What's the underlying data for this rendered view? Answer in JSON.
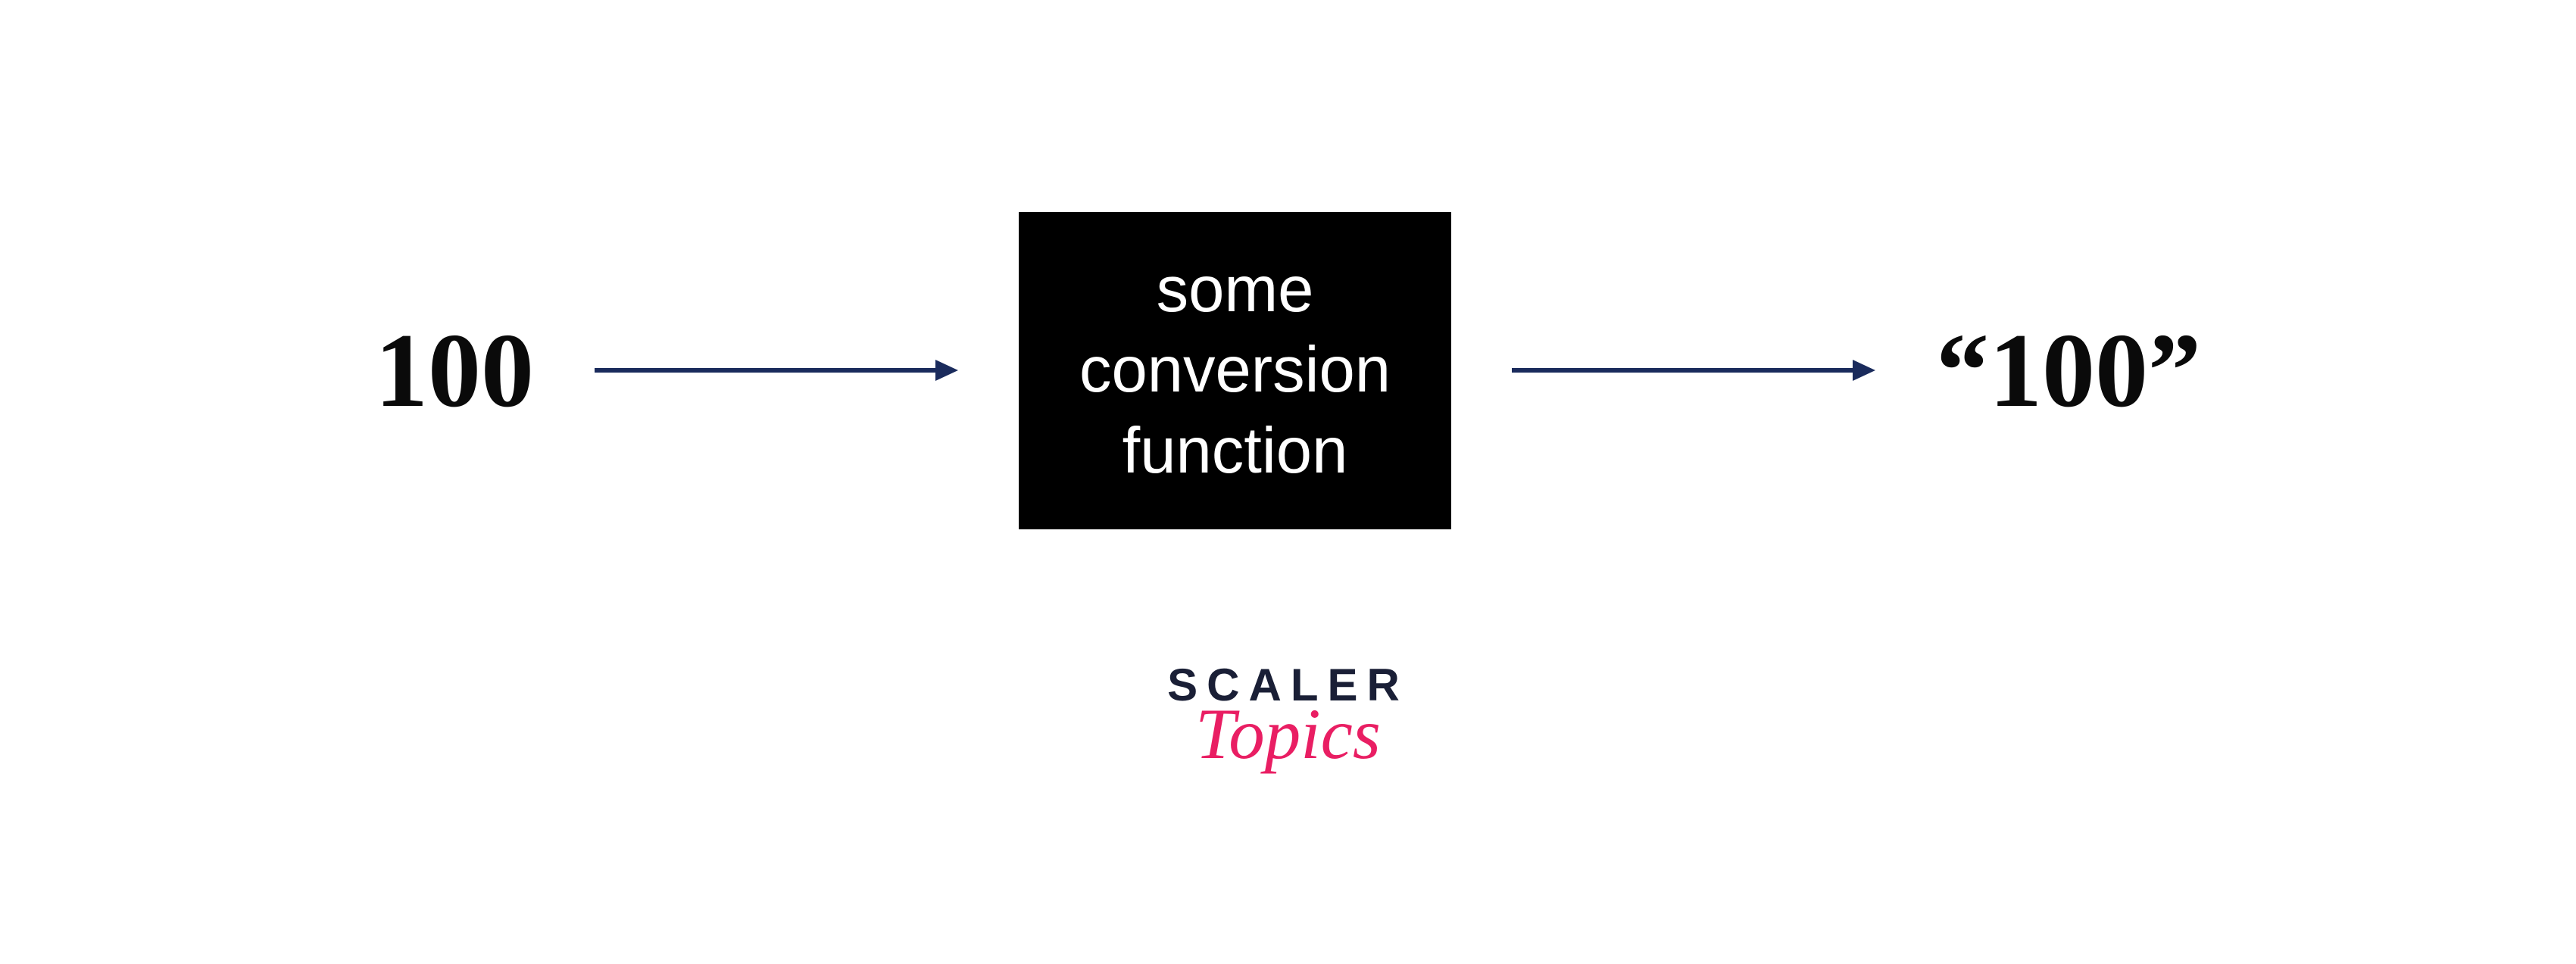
{
  "diagram": {
    "input": "100",
    "box_line1": "some",
    "box_line2": "conversion",
    "box_line3": "function",
    "output": "“100”"
  },
  "logo": {
    "line1": "SCALER",
    "line2": "Topics"
  },
  "colors": {
    "arrow": "#1a2b5c",
    "box_bg": "#000000",
    "box_text": "#ffffff",
    "text": "#0a0a0a",
    "logo_dark": "#1a1f36",
    "logo_accent": "#e91e63"
  }
}
